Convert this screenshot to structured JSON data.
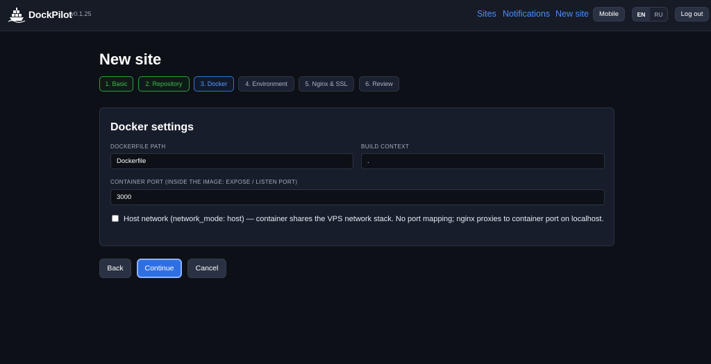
{
  "header": {
    "brand": "DockPilot",
    "version": "v0.1.25",
    "nav": {
      "sites": "Sites",
      "notifications": "Notifications",
      "new_site": "New site"
    },
    "mobile_label": "Mobile",
    "languages": {
      "en": "EN",
      "ru": "RU",
      "active": "EN"
    },
    "logout_label": "Log out"
  },
  "page": {
    "title": "New site",
    "steps": [
      {
        "label": "1. Basic",
        "state": "done"
      },
      {
        "label": "2. Repository",
        "state": "done"
      },
      {
        "label": "3. Docker",
        "state": "current"
      },
      {
        "label": "4. Environment",
        "state": "todo"
      },
      {
        "label": "5. Nginx & SSL",
        "state": "todo"
      },
      {
        "label": "6. Review",
        "state": "todo"
      }
    ]
  },
  "docker_settings": {
    "title": "Docker settings",
    "dockerfile_path": {
      "label": "DOCKERFILE PATH",
      "value": "Dockerfile"
    },
    "build_context": {
      "label": "BUILD CONTEXT",
      "value": "."
    },
    "container_port": {
      "label": "CONTAINER PORT (INSIDE THE IMAGE: EXPOSE / LISTEN PORT)",
      "value": "3000"
    },
    "host_network": {
      "checked": false,
      "label": "Host network (network_mode: host) — container shares the VPS network stack. No port mapping; nginx proxies to container port on localhost."
    }
  },
  "actions": {
    "back": "Back",
    "continue": "Continue",
    "cancel": "Cancel"
  },
  "colors": {
    "accent": "#4c8dff",
    "primary_button": "#2f6fe4",
    "done_step": "#3fb950",
    "background": "#0d1117"
  }
}
